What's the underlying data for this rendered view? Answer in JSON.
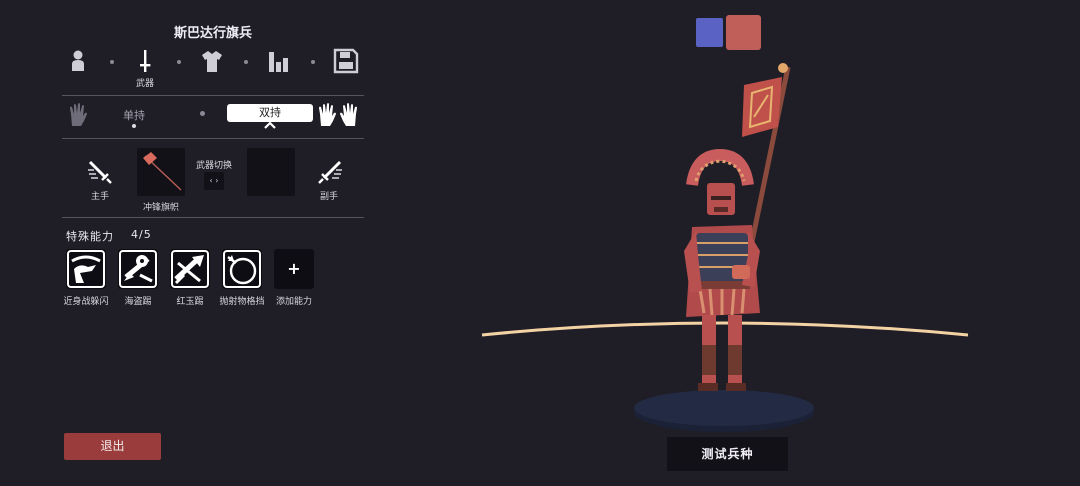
{
  "unit": {
    "title": "斯巴达行旗兵"
  },
  "tabs": [
    {
      "icon": "person-icon",
      "label": ""
    },
    {
      "icon": "sword-icon",
      "label": "武器"
    },
    {
      "icon": "shirt-icon",
      "label": ""
    },
    {
      "icon": "stats-icon",
      "label": ""
    },
    {
      "icon": "save-icon",
      "label": ""
    }
  ],
  "hand_mode": {
    "single_label": "单持",
    "dual_label": "双持",
    "selected": "dual"
  },
  "weapons": {
    "main_hand_label": "主手",
    "main_weapon_name": "冲锋旗帜",
    "swap_label": "武器切换",
    "swap_button": "‹ ›",
    "off_hand_label": "副手"
  },
  "abilities": {
    "heading": "特殊能力",
    "count": "4/5",
    "items": [
      {
        "label": "近身战躲闪",
        "icon": "dodge-icon"
      },
      {
        "label": "海盗踢",
        "icon": "pirate-kick-icon"
      },
      {
        "label": "红玉踢",
        "icon": "ruby-kick-icon"
      },
      {
        "label": "抛射物格挡",
        "icon": "projectile-block-icon"
      }
    ],
    "add_symbol": "+",
    "add_label": "添加能力"
  },
  "buttons": {
    "exit": "退出",
    "test_unit": "测试兵种"
  },
  "teams": {
    "blue": "#5a63c4",
    "red": "#c05e5a",
    "selected": "red"
  },
  "colors": {
    "background": "#1f1e27",
    "panel_dark": "#121118",
    "accent_red": "#9a3c3c"
  }
}
